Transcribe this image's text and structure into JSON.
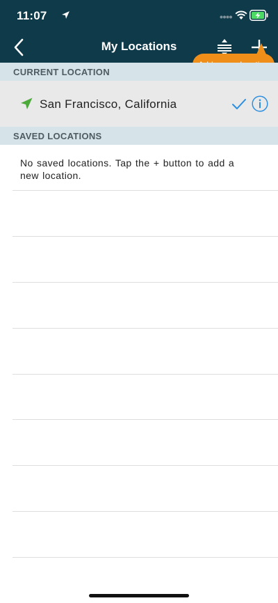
{
  "status_bar": {
    "time": "11:07"
  },
  "nav": {
    "title": "My Locations"
  },
  "tooltip": {
    "text": "Add a new location"
  },
  "sections": {
    "current": "CURRENT LOCATION",
    "saved": "SAVED LOCATIONS"
  },
  "current_location": {
    "label": "San Francisco, California"
  },
  "saved_locations": {
    "empty_message": "No saved locations. Tap the + button to add a new location."
  },
  "icons": {
    "back": "chevron-left",
    "sort": "sort",
    "add": "plus",
    "location": "location-arrow",
    "selected": "checkmark",
    "info": "info-circle"
  },
  "colors": {
    "header_bg": "#0e3a4a",
    "section_bg": "#d6e4ea",
    "accent_blue": "#2b8ee0",
    "accent_orange": "#ef8f1a",
    "location_green": "#4caa3a",
    "selected_row_bg": "#e9e9e9"
  }
}
